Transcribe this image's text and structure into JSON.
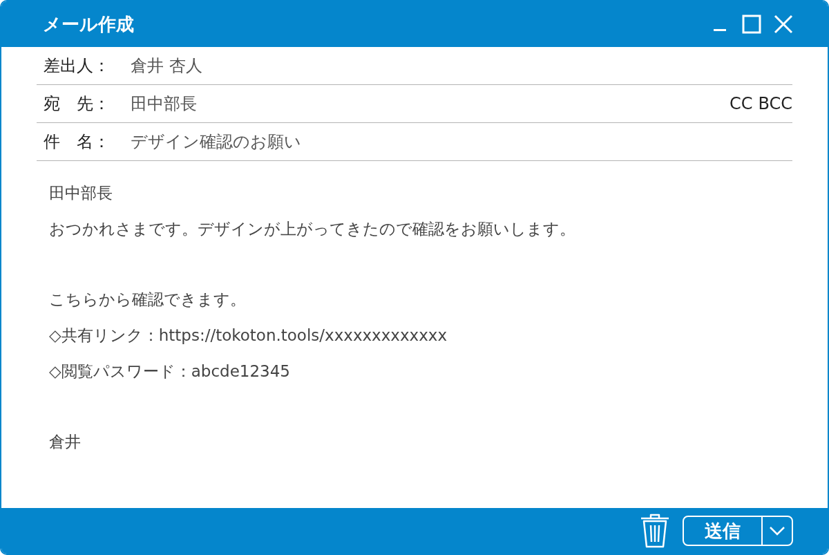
{
  "window": {
    "title": "メール作成"
  },
  "header_fields": [
    {
      "label": "差出人：",
      "value": "倉井 杏人"
    },
    {
      "label": "宛　先：",
      "value": "田中部長",
      "links": [
        "CC",
        "BCC"
      ]
    },
    {
      "label": "件　名：",
      "value": "デザイン確認のお願い"
    }
  ],
  "body": [
    [
      "田中部長",
      "おつかれさまです。デザインが上がってきたので確認をお願いします。"
    ],
    [
      "こちらから確認できます。",
      "◇共有リンク：https://tokoton.tools/xxxxxxxxxxxxx",
      "◇閲覧パスワード：abcde12345"
    ],
    [
      "倉井"
    ]
  ],
  "footer": {
    "send_button": "送信"
  }
}
